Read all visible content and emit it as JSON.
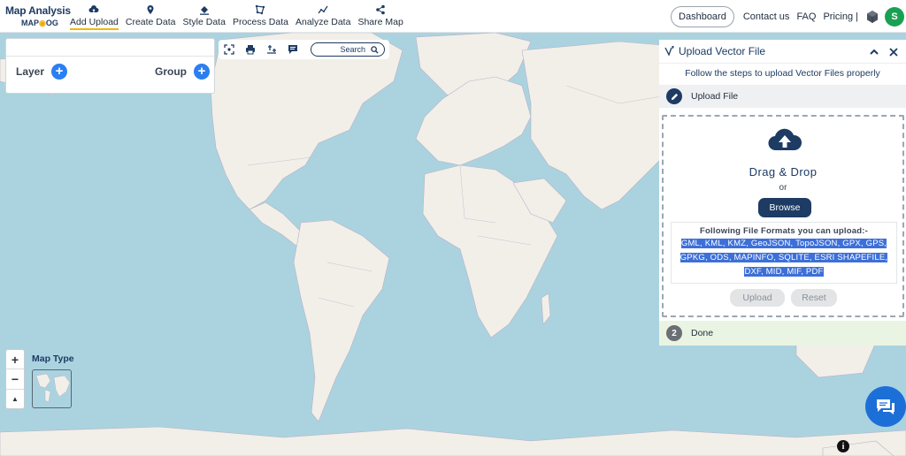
{
  "app": {
    "logo_main": "Map Analysis",
    "logo_sub_prefix": "MAP",
    "logo_sub_suffix": "OG"
  },
  "nav": {
    "items": [
      {
        "label": "Add Upload",
        "icon": "cloud-upload-icon",
        "active": true
      },
      {
        "label": "Create Data",
        "icon": "map-pin-icon",
        "active": false
      },
      {
        "label": "Style Data",
        "icon": "paint-bucket-icon",
        "active": false
      },
      {
        "label": "Process Data",
        "icon": "polygon-edit-icon",
        "active": false
      },
      {
        "label": "Analyze Data",
        "icon": "analyze-icon",
        "active": false
      },
      {
        "label": "Share Map",
        "icon": "share-icon",
        "active": false
      }
    ],
    "dashboard": "Dashboard",
    "contact": "Contact us",
    "faq": "FAQ",
    "pricing": "Pricing |",
    "avatar_initial": "S"
  },
  "layer_panel": {
    "layer_label": "Layer",
    "group_label": "Group"
  },
  "toolbar": {
    "search_label": "Search"
  },
  "map_controls": {
    "zoom_in": "+",
    "zoom_out": "−",
    "compass": "▲",
    "map_type_label": "Map Type"
  },
  "upload_panel": {
    "title": "Upload Vector File",
    "subtitle": "Follow the steps to upload Vector Files properly",
    "step1_label": "Upload File",
    "drop_title": "Drag & Drop",
    "drop_or": "or",
    "browse": "Browse",
    "formats_header": "Following File Formats you can upload:-",
    "formats_list": "GML, KML, KMZ, GeoJSON, TopoJSON, GPX, GPS, GPKG, ODS, MAPINFO, SQLITE, ESRI SHAPEFILE, DXF, MID, MIF, PDF",
    "upload_btn": "Upload",
    "reset_btn": "Reset",
    "step2_num": "2",
    "step2_label": "Done"
  },
  "misc": {
    "info": "i"
  },
  "colors": {
    "brand_navy": "#1d3b63",
    "accent_yellow": "#f2b705",
    "water": "#aad3df",
    "land": "#f2efe9",
    "avatar_green": "#1aa052",
    "plus_blue": "#2b7ff0",
    "chat_blue": "#1d6fd8"
  }
}
